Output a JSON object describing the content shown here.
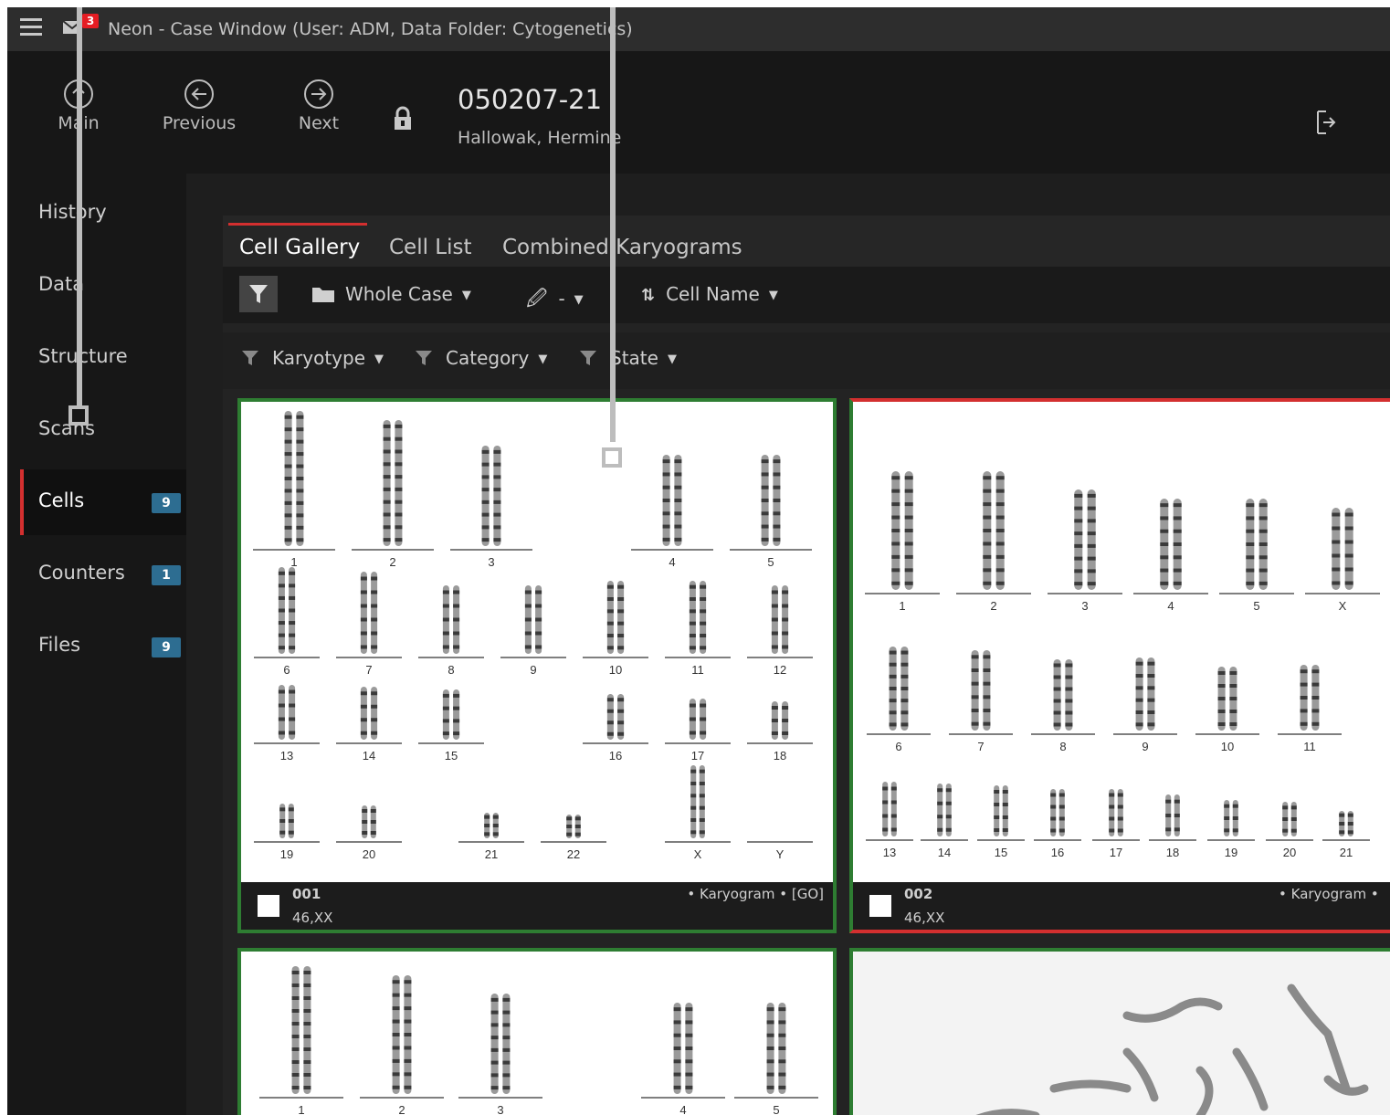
{
  "window": {
    "title": "Neon - Case Window (User: ADM, Data Folder: Cytogenetics)",
    "notification_count": "3"
  },
  "toolbar": {
    "main_label": "Main",
    "previous_label": "Previous",
    "next_label": "Next",
    "case_id": "050207-21",
    "patient_name": "Hallowak, Hermine"
  },
  "sidebar": {
    "items": [
      {
        "label": "History",
        "badge": ""
      },
      {
        "label": "Data",
        "badge": ""
      },
      {
        "label": "Structure",
        "badge": ""
      },
      {
        "label": "Scans",
        "badge": ""
      },
      {
        "label": "Cells",
        "badge": "9"
      },
      {
        "label": "Counters",
        "badge": "1"
      },
      {
        "label": "Files",
        "badge": "9"
      }
    ]
  },
  "tabs": [
    "Cell Gallery",
    "Cell List",
    "Combined Karyograms"
  ],
  "filters": {
    "scope": "Whole Case",
    "attachment": "-",
    "sort": "Cell Name",
    "karyotype": "Karyotype",
    "category": "Category",
    "state": "State"
  },
  "cells": [
    {
      "name": "001",
      "karyotype": "46,XX",
      "tags": "• Karyogram • [GO]"
    },
    {
      "name": "002",
      "karyotype": "46,XX",
      "tags": "• Karyogram •"
    }
  ],
  "card1_labels": [
    "1",
    "2",
    "3",
    "4",
    "5",
    "6",
    "7",
    "8",
    "9",
    "10",
    "11",
    "12",
    "13",
    "14",
    "15",
    "16",
    "17",
    "18",
    "19",
    "20",
    "21",
    "22",
    "X",
    "Y"
  ],
  "card2_labels": [
    "1",
    "2",
    "3",
    "4",
    "5",
    "X",
    "6",
    "7",
    "8",
    "9",
    "10",
    "11",
    "13",
    "14",
    "15",
    "16",
    "17",
    "18",
    "19",
    "20",
    "21"
  ],
  "card3_labels": [
    "1",
    "2",
    "3",
    "4",
    "5"
  ],
  "colors": {
    "accent_red": "#d32f2f",
    "border_green": "#2e7d32",
    "badge_blue": "#2d6d91"
  }
}
